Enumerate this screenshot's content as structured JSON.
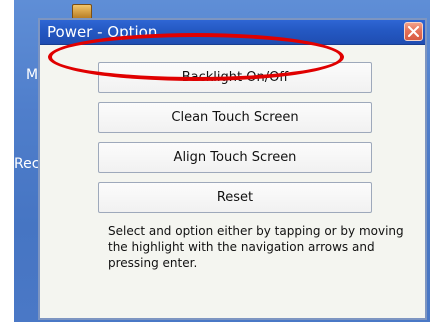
{
  "desktop": {
    "label_top": "My",
    "label_bottom": "Rec"
  },
  "window": {
    "title": "Power - Option",
    "close_icon": "close-icon"
  },
  "options": [
    {
      "label": "Backlight On/Off"
    },
    {
      "label": "Clean Touch Screen"
    },
    {
      "label": "Align Touch Screen"
    },
    {
      "label": "Reset"
    }
  ],
  "help": {
    "text": "Select and option either by tapping or by moving the highlight with the navigation arrows and pressing enter."
  },
  "colors": {
    "titlebar": "#2458c2",
    "desktop": "#4f7ecb",
    "highlight": "#e00000",
    "close_button": "#e57259"
  }
}
